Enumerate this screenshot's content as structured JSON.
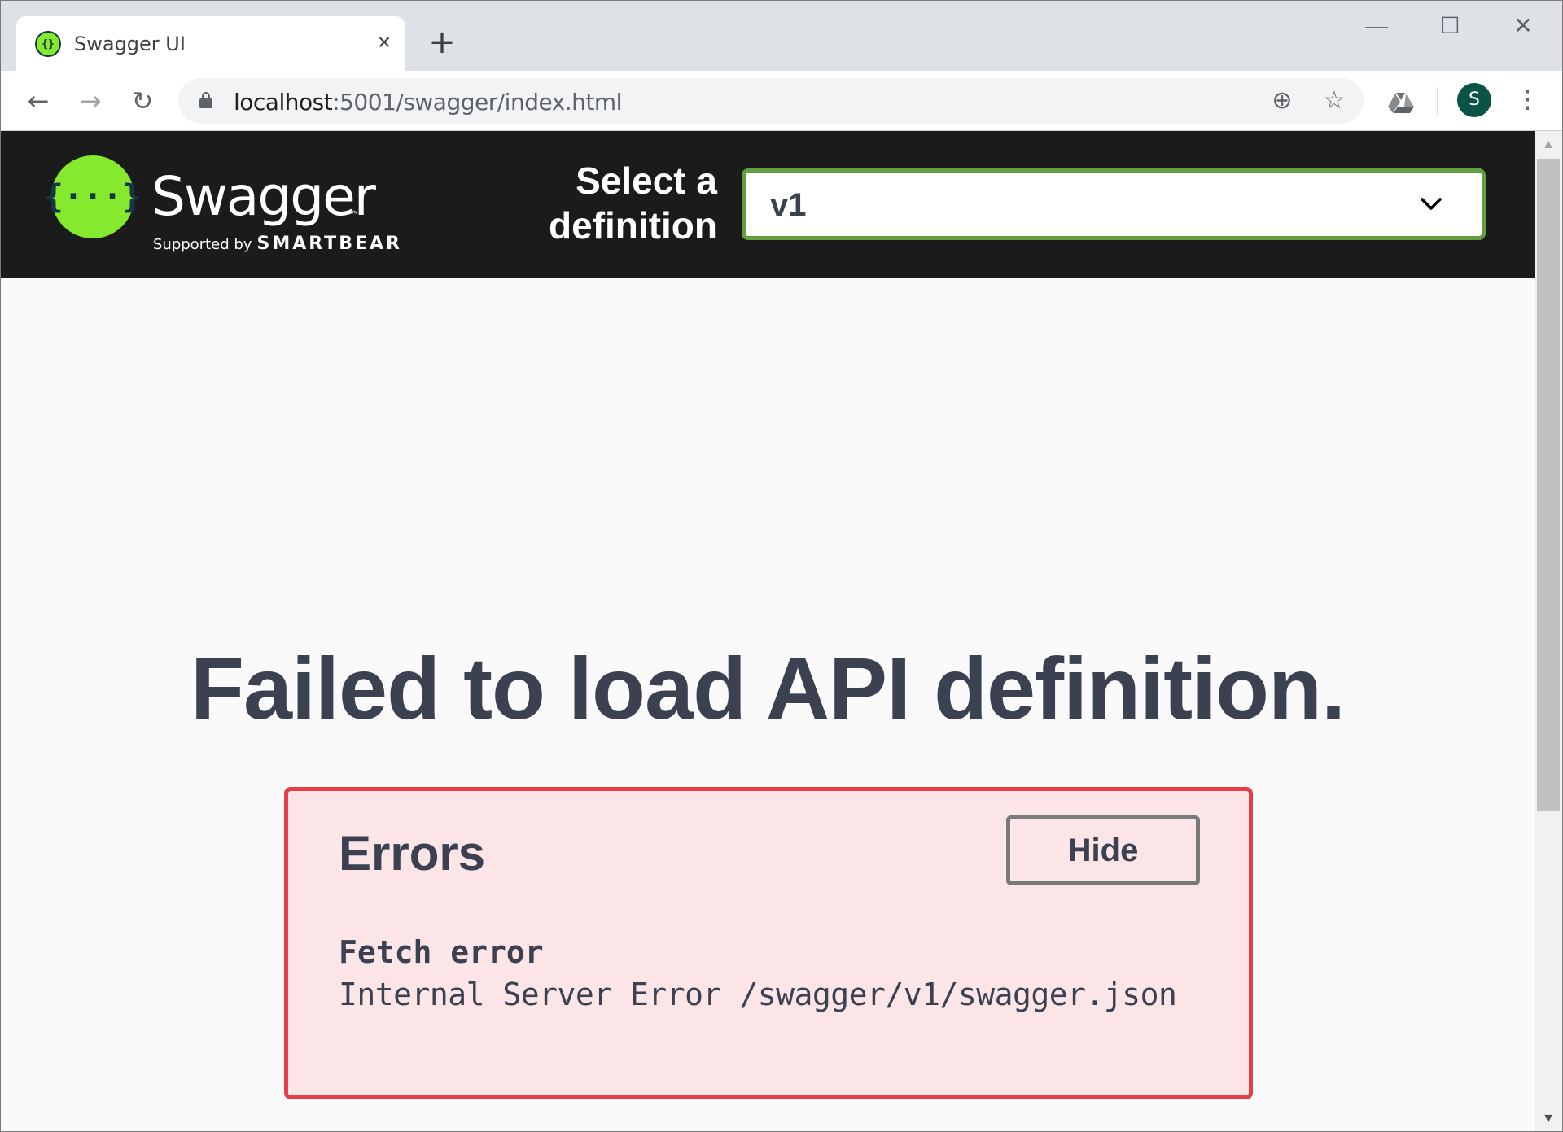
{
  "browser": {
    "tab": {
      "title": "Swagger UI",
      "close_glyph": "×"
    },
    "new_tab_glyph": "+",
    "window_controls": {
      "minimize": "—",
      "maximize": "☐",
      "close": "✕"
    },
    "nav": {
      "back": "←",
      "forward": "→",
      "reload": "↻"
    },
    "address": {
      "host": "localhost",
      "rest": ":5001/swagger/index.html"
    },
    "icons": {
      "zoom": "⊕",
      "bookmark": "☆"
    },
    "avatar_letter": "S",
    "menu_glyph": "⋮"
  },
  "swagger": {
    "logo_glyph": "{···}",
    "logo_word": "Swagger",
    "logo_tm": "™",
    "supported_by": "Supported by",
    "brand": "SMARTBEAR",
    "select_label": "Select a definition",
    "select_value": "v1"
  },
  "main": {
    "failed_message": "Failed to load API definition.",
    "errors": {
      "heading": "Errors",
      "hide_label": "Hide",
      "error_title": "Fetch error",
      "error_message": "Internal Server Error /swagger/v1/swagger.json"
    }
  },
  "colors": {
    "swagger_green": "#85ea2d",
    "topbar_bg": "#1b1b1b",
    "select_border": "#62a03f",
    "error_border": "#e53e47",
    "error_bg": "#fbe5e6",
    "text_dark": "#3b4151",
    "avatar_bg": "#0b5345"
  }
}
